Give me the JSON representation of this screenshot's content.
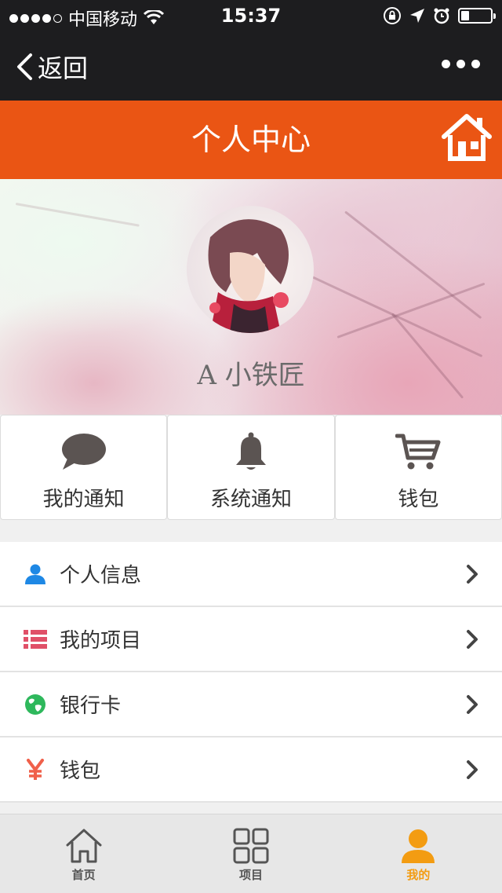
{
  "status_bar": {
    "carrier": "中国移动",
    "time": "15:37"
  },
  "nav": {
    "back_label": "返回"
  },
  "header": {
    "title": "个人中心"
  },
  "profile": {
    "username": "A 小铁匠"
  },
  "quick_actions": [
    {
      "label": "我的通知",
      "icon": "chat-bubble-icon"
    },
    {
      "label": "系统通知",
      "icon": "bell-icon"
    },
    {
      "label": "钱包",
      "icon": "cart-icon"
    }
  ],
  "menu": [
    {
      "label": "个人信息",
      "icon": "user-icon",
      "color": "#1e88e5"
    },
    {
      "label": "我的项目",
      "icon": "list-icon",
      "color": "#e05068"
    },
    {
      "label": "银行卡",
      "icon": "globe-icon",
      "color": "#2eb85c"
    },
    {
      "label": "钱包",
      "icon": "yen-icon",
      "color": "#f0604a"
    }
  ],
  "tabbar": [
    {
      "label": "首页",
      "icon": "home-outline-icon",
      "active": false
    },
    {
      "label": "项目",
      "icon": "grid-icon",
      "active": false
    },
    {
      "label": "我的",
      "icon": "person-icon",
      "active": true
    }
  ],
  "colors": {
    "header_bg": "#ea5514",
    "active_tab": "#f39c12",
    "statusbar_bg": "#1d1d1f"
  }
}
